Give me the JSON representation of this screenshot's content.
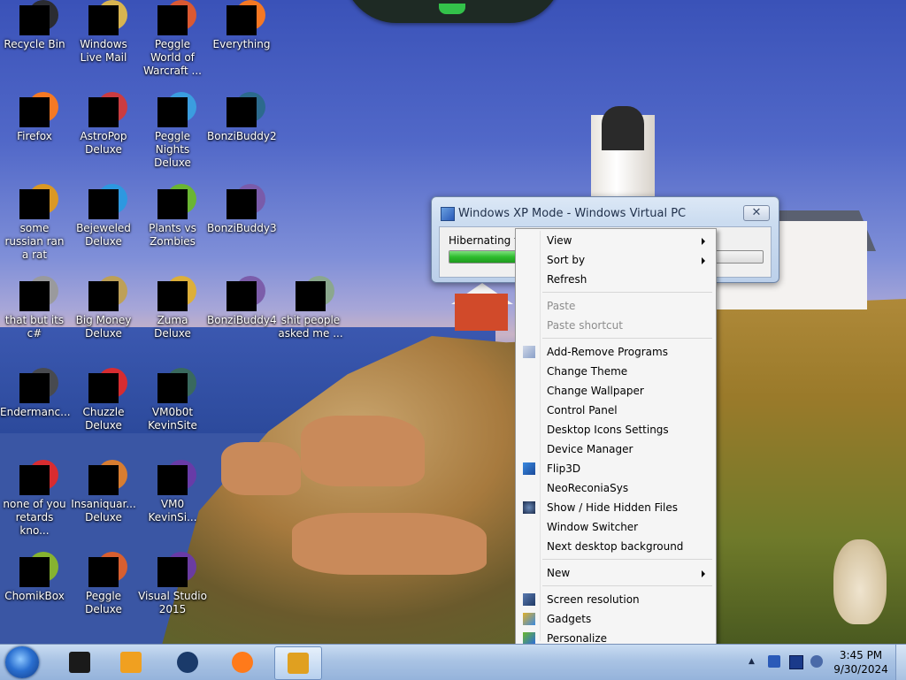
{
  "desktop_icons": [
    {
      "label": "Recycle Bin",
      "icon": "recycle-bin-icon",
      "color": "#2a2a2a"
    },
    {
      "label": "Windows Live Mail",
      "icon": "mail-icon",
      "color": "#e0b94a"
    },
    {
      "label": "Peggle World of Warcraft ...",
      "icon": "peggle-icon",
      "color": "#e45a2a"
    },
    {
      "label": "Everything",
      "icon": "search-icon",
      "color": "#ff7a1a"
    },
    {
      "label": "Firefox",
      "icon": "firefox-icon",
      "color": "#ff7a1a"
    },
    {
      "label": "AstroPop Deluxe",
      "icon": "astropop-icon",
      "color": "#d23a3a"
    },
    {
      "label": "Peggle Nights Deluxe",
      "icon": "peggle-icon",
      "color": "#3aa0e0"
    },
    {
      "label": "BonziBuddy2",
      "icon": "bonzibuddy-icon",
      "color": "#2a6a8a"
    },
    {
      "label": "some russian ran a rat",
      "icon": "document-icon",
      "color": "#e09a1a"
    },
    {
      "label": "Bejeweled Deluxe",
      "icon": "bejeweled-icon",
      "color": "#2a9ae0"
    },
    {
      "label": "Plants vs Zombies",
      "icon": "plants-icon",
      "color": "#6ab82a"
    },
    {
      "label": "BonziBuddy3",
      "icon": "bonzibuddy-icon",
      "color": "#7a5aa8"
    },
    {
      "label": "that but its c#",
      "icon": "document-icon",
      "color": "#9a9a9a"
    },
    {
      "label": "Big Money Deluxe",
      "icon": "money-icon",
      "color": "#c0a050"
    },
    {
      "label": "Zuma Deluxe",
      "icon": "zuma-icon",
      "color": "#e0b030"
    },
    {
      "label": "BonziBuddy4",
      "icon": "bonzibuddy-icon",
      "color": "#7a5aa8"
    },
    {
      "label": "shit people asked me ...",
      "icon": "folder-icon",
      "color": "#8aa88a"
    },
    {
      "label": "Endermanc...",
      "icon": "app-icon",
      "color": "#4a4a4a"
    },
    {
      "label": "Chuzzle Deluxe",
      "icon": "chuzzle-icon",
      "color": "#e02a2a"
    },
    {
      "label": "VM0b0t KevinSite",
      "icon": "vm-icon",
      "color": "#3a6a5a"
    },
    {
      "label": "none of you retards kno...",
      "icon": "opera-icon",
      "color": "#e02a2a"
    },
    {
      "label": "Insaniquar... Deluxe",
      "icon": "insaniquarium-icon",
      "color": "#e0802a"
    },
    {
      "label": "VM0 KevinSi...",
      "icon": "vm-icon",
      "color": "#6a3aa8"
    },
    {
      "label": "ChomikBox",
      "icon": "chomikbox-icon",
      "color": "#8ab82a"
    },
    {
      "label": "Peggle Deluxe",
      "icon": "peggle-icon",
      "color": "#e0602a"
    },
    {
      "label": "Visual Studio 2015",
      "icon": "visual-studio-icon",
      "color": "#6a3aa8"
    }
  ],
  "xp_window": {
    "title": "Windows XP Mode - Windows Virtual PC",
    "status": "Hibernating th",
    "progress": 0.21,
    "close_glyph": "✕"
  },
  "context_menu": {
    "items": [
      {
        "label": "View",
        "submenu": true
      },
      {
        "label": "Sort by",
        "submenu": true
      },
      {
        "label": "Refresh"
      },
      {
        "label": "Paste",
        "disabled": true
      },
      {
        "label": "Paste shortcut",
        "disabled": true
      },
      {
        "label": "Add-Remove Programs",
        "icon": "programs-icon"
      },
      {
        "label": "Change Theme"
      },
      {
        "label": "Change Wallpaper"
      },
      {
        "label": "Control Panel"
      },
      {
        "label": "Desktop Icons Settings"
      },
      {
        "label": "Device Manager"
      },
      {
        "label": "Flip3D",
        "icon": "flip3d-icon"
      },
      {
        "label": "NeoReconiaSys"
      },
      {
        "label": "Show / Hide Hidden Files",
        "icon": "hidden-files-icon"
      },
      {
        "label": "Window Switcher"
      },
      {
        "label": "Next desktop background"
      },
      {
        "label": "New",
        "submenu": true
      },
      {
        "label": "Screen resolution",
        "icon": "screen-resolution-icon"
      },
      {
        "label": "Gadgets",
        "icon": "gadgets-icon"
      },
      {
        "label": "Personalize",
        "icon": "personalize-icon"
      }
    ]
  },
  "taskbar": {
    "pinned": [
      {
        "icon": "media-center-icon",
        "color": "#1a1a1a"
      },
      {
        "icon": "media-player-icon",
        "color": "#f0a020"
      },
      {
        "icon": "globe-icon",
        "color": "#1a3a6a"
      },
      {
        "icon": "firefox-icon",
        "color": "#ff7a1a"
      },
      {
        "icon": "virtual-pc-icon",
        "color": "#e0a020"
      }
    ],
    "clock_time": "3:45 PM",
    "clock_date": "9/30/2024",
    "tray_arrow": "▲"
  }
}
